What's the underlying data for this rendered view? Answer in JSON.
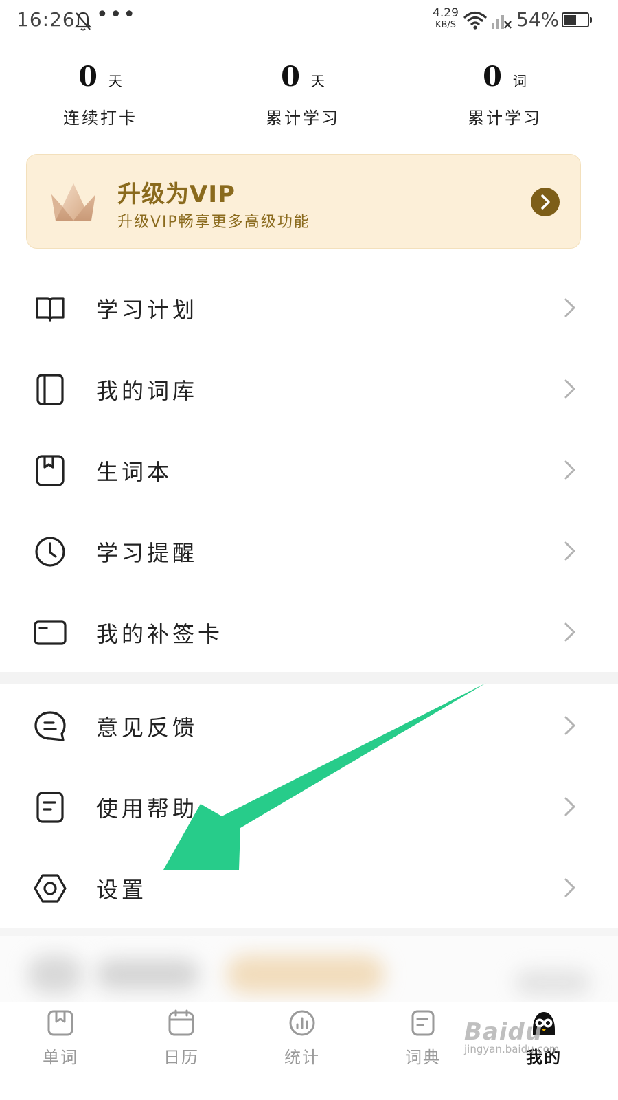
{
  "status_bar": {
    "time": "16:26",
    "more": "•••",
    "net_speed_value": "4.29",
    "net_speed_unit": "KB/S",
    "battery_percent": "54%",
    "battery_level": 0.54,
    "icons": [
      "mute-bell-icon",
      "wifi-icon",
      "signal-off-icon",
      "battery-icon"
    ]
  },
  "stats": [
    {
      "value": "0",
      "unit": "天",
      "label": "连续打卡"
    },
    {
      "value": "0",
      "unit": "天",
      "label": "累计学习"
    },
    {
      "value": "0",
      "unit": "词",
      "label": "累计学习"
    }
  ],
  "vip": {
    "title": "升级为VIP",
    "subtitle": "升级VIP畅享更多高级功能",
    "accent_color": "#8a6a1d",
    "background_color": "#fcefd8"
  },
  "menu_group_1": [
    {
      "label": "学习计划",
      "icon": "open-book-icon"
    },
    {
      "label": "我的词库",
      "icon": "word-library-icon"
    },
    {
      "label": "生词本",
      "icon": "vocabulary-notebook-icon"
    },
    {
      "label": "学习提醒",
      "icon": "clock-icon"
    },
    {
      "label": "我的补签卡",
      "icon": "card-icon"
    }
  ],
  "menu_group_2": [
    {
      "label": "意见反馈",
      "icon": "feedback-bubble-icon"
    },
    {
      "label": "使用帮助",
      "icon": "help-document-icon"
    },
    {
      "label": "设置",
      "icon": "settings-hexagon-icon"
    }
  ],
  "tabs": [
    {
      "label": "单词",
      "icon": "word-tab-icon",
      "active": false
    },
    {
      "label": "日历",
      "icon": "calendar-icon",
      "active": false
    },
    {
      "label": "统计",
      "icon": "statistics-icon",
      "active": false
    },
    {
      "label": "词典",
      "icon": "dictionary-icon",
      "active": false
    },
    {
      "label": "我的",
      "icon": "mascot-avatar-icon",
      "active": true
    }
  ],
  "annotation": {
    "arrow_color": "#27cc8a"
  },
  "watermark": {
    "main": "Baidu",
    "sub": "jingyan.baidu.com"
  }
}
